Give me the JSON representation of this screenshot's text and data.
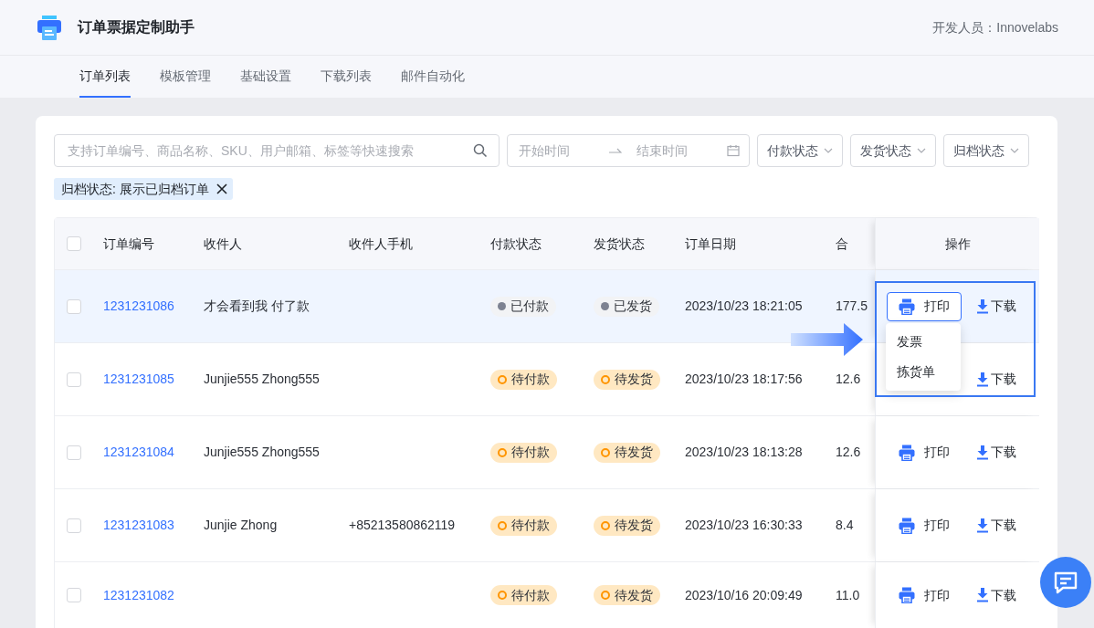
{
  "app": {
    "title": "订单票据定制助手",
    "developer": "开发人员：Innovelabs"
  },
  "tabs": [
    {
      "label": "订单列表",
      "selected": true
    },
    {
      "label": "模板管理",
      "selected": false
    },
    {
      "label": "基础设置",
      "selected": false
    },
    {
      "label": "下载列表",
      "selected": false
    },
    {
      "label": "邮件自动化",
      "selected": false
    }
  ],
  "search": {
    "placeholder": "支持订单编号、商品名称、SKU、用户邮箱、标签等快速搜索"
  },
  "date_range": {
    "start_placeholder": "开始时间",
    "end_placeholder": "结束时间"
  },
  "filters": [
    "付款状态",
    "发货状态",
    "归档状态"
  ],
  "active_filters": [
    {
      "label": "归档状态: 展示已归档订单"
    }
  ],
  "table": {
    "all_checked": false,
    "columns": [
      "订单编号",
      "收件人",
      "收件人手机",
      "付款状态",
      "发货状态",
      "订单日期",
      "合",
      "操作"
    ],
    "rows": [
      {
        "selected": true,
        "checked": false,
        "order_no": "1231231086",
        "receiver": "才会看到我 付了款",
        "payment": {
          "label": "已付款",
          "kind": "done"
        },
        "shipping": {
          "label": "已发货",
          "kind": "done"
        },
        "date": "2023/10/23 18:21:05",
        "total": "177.5",
        "print": "打印",
        "download": "下载",
        "print_open": true
      },
      {
        "selected": false,
        "checked": false,
        "order_no": "1231231085",
        "receiver": "Junjie555 Zhong555",
        "payment": {
          "label": "待付款",
          "kind": "pending"
        },
        "shipping": {
          "label": "待发货",
          "kind": "pending"
        },
        "date": "2023/10/23 18:17:56",
        "total": "12.6",
        "download": "下载",
        "print_open": false
      },
      {
        "selected": false,
        "checked": false,
        "order_no": "1231231084",
        "receiver": "Junjie555 Zhong555",
        "payment": {
          "label": "待付款",
          "kind": "pending"
        },
        "shipping": {
          "label": "待发货",
          "kind": "pending"
        },
        "date": "2023/10/23 18:13:28",
        "total": "12.6",
        "print": "打印",
        "download": "下载",
        "print_open": false
      },
      {
        "selected": false,
        "checked": false,
        "order_no": "1231231083",
        "receiver": "Junjie Zhong",
        "phone": "+85213580862119",
        "payment": {
          "label": "待付款",
          "kind": "pending"
        },
        "shipping": {
          "label": "待发货",
          "kind": "pending"
        },
        "date": "2023/10/23 16:30:33",
        "total": "8.4",
        "print": "打印",
        "download": "下载",
        "print_open": false
      },
      {
        "selected": false,
        "checked": false,
        "order_no": "1231231082",
        "payment": {
          "label": "待付款",
          "kind": "pending"
        },
        "shipping": {
          "label": "待发货",
          "kind": "pending"
        },
        "date": "2023/10/16 20:09:49",
        "total": "11.0",
        "print": "打印",
        "download": "下载",
        "print_open": false
      }
    ]
  },
  "print_menu": {
    "items": [
      "发票",
      "拣货单"
    ]
  }
}
